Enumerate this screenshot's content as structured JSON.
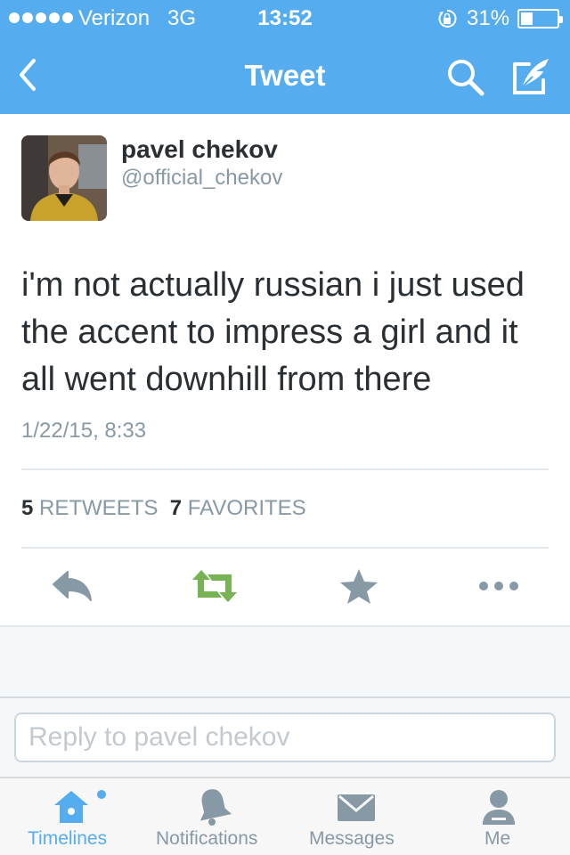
{
  "status_bar": {
    "carrier": "Verizon",
    "network": "3G",
    "time": "13:52",
    "battery": "31%",
    "battery_level": 0.31,
    "signal_bars": 5
  },
  "nav": {
    "title": "Tweet",
    "back_icon": "chevron-left-icon",
    "search_icon": "search-icon",
    "compose_icon": "compose-icon"
  },
  "tweet": {
    "name": "pavel chekov",
    "handle": "@official_chekov",
    "text": "i'm not actually russian i just used the accent to impress a girl and it all went downhill from there",
    "timestamp": "1/22/15, 8:33",
    "retweets_count": "5",
    "retweets_label": "RETWEETS",
    "favorites_count": "7",
    "favorites_label": "FAVORITES"
  },
  "actions": [
    "reply-icon",
    "retweet-icon",
    "favorite-icon",
    "more-icon"
  ],
  "reply": {
    "placeholder": "Reply to pavel chekov"
  },
  "tabs": [
    {
      "label": "Timelines",
      "icon": "home-icon",
      "active": true
    },
    {
      "label": "Notifications",
      "icon": "bell-icon",
      "active": false
    },
    {
      "label": "Messages",
      "icon": "envelope-icon",
      "active": false
    },
    {
      "label": "Me",
      "icon": "person-icon",
      "active": false
    }
  ],
  "colors": {
    "brand_blue": "#55acee",
    "retweet_green": "#77b255",
    "muted_gray": "#8899a6",
    "text_dark": "#292f33"
  }
}
